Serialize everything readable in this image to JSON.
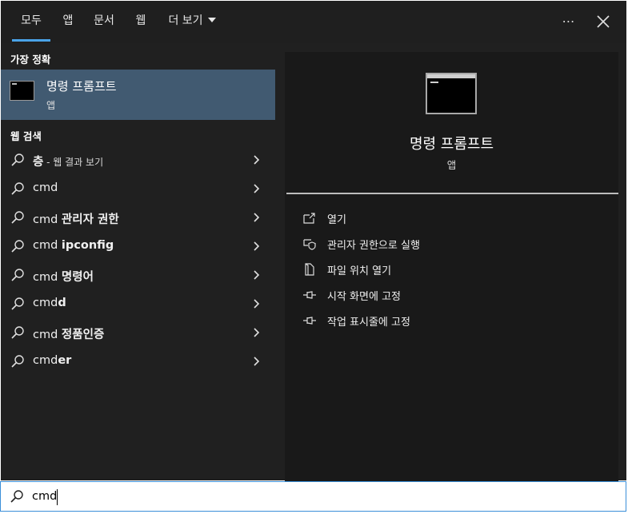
{
  "tabs": [
    {
      "label": "모두",
      "active": true
    },
    {
      "label": "앱"
    },
    {
      "label": "문서"
    },
    {
      "label": "웹"
    },
    {
      "label": "더 보기"
    }
  ],
  "best_match": {
    "header": "가장 정확",
    "title": "명령 프롬프트",
    "subtitle": "앱",
    "icon": "cmd-app-icon"
  },
  "web_search": {
    "header": "웹 검색",
    "items": [
      {
        "prefix": "",
        "bold": "층",
        "suffix": " - 웹 결과 보기"
      },
      {
        "prefix": "cmd",
        "bold": "",
        "suffix": ""
      },
      {
        "prefix": "cmd ",
        "bold": "관리자 권한",
        "suffix": ""
      },
      {
        "prefix": "cmd ",
        "bold": "ipconfig",
        "suffix": ""
      },
      {
        "prefix": "cmd ",
        "bold": "명령어",
        "suffix": ""
      },
      {
        "prefix": "cmd",
        "bold": "d",
        "suffix": ""
      },
      {
        "prefix": "cmd ",
        "bold": "정품인증",
        "suffix": ""
      },
      {
        "prefix": "cmd",
        "bold": "er",
        "suffix": ""
      }
    ]
  },
  "preview": {
    "title": "명령 프롬프트",
    "subtitle": "앱",
    "actions": [
      {
        "label": "열기",
        "icon": "open-icon"
      },
      {
        "label": "관리자 권한으로 실행",
        "icon": "run-as-admin-icon"
      },
      {
        "label": "파일 위치 열기",
        "icon": "file-location-icon"
      },
      {
        "label": "시작 화면에 고정",
        "icon": "pin-icon"
      },
      {
        "label": "작업 표시줄에 고정",
        "icon": "pin-icon"
      }
    ]
  },
  "search": {
    "value": "cmd",
    "placeholder": ""
  },
  "colors": {
    "accent": "#4aa3e8",
    "selected_bg": "#415a71",
    "panel_bg": "#202020",
    "preview_bg": "#191919"
  }
}
